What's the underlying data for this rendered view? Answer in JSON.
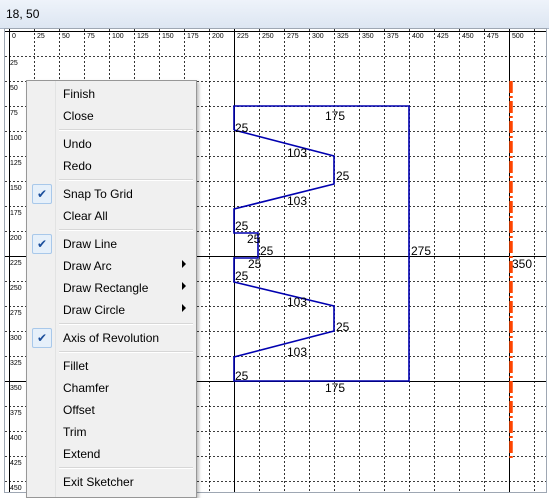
{
  "window": {
    "title": "18, 50"
  },
  "ruler": {
    "x_labels": [
      "0",
      "25",
      "50",
      "75",
      "100",
      "125",
      "150",
      "175",
      "200",
      "225",
      "250",
      "275",
      "300",
      "325",
      "350",
      "375",
      "400",
      "425",
      "450",
      "475",
      "500"
    ],
    "y_labels": [
      "25",
      "50",
      "75",
      "100",
      "125",
      "150",
      "175",
      "200",
      "225",
      "250",
      "275",
      "300",
      "325",
      "350",
      "375",
      "400",
      "425",
      "450"
    ]
  },
  "sketch": {
    "dims": {
      "top": "175",
      "bottom": "175",
      "right": "275",
      "d25_a": "25",
      "d103_a": "103",
      "d25_b": "25",
      "d103_b": "103",
      "d25_c": "25",
      "d25_d": "25",
      "d25_e": "25",
      "d25_f": "25",
      "d25_g": "25",
      "d103_c": "103",
      "d25_h": "25",
      "d103_d": "103",
      "d25_i": "25"
    },
    "axis_label": "350",
    "colors": {
      "profile": "#0000b0",
      "axis": "#ff4500",
      "grid": "#000000"
    }
  },
  "menu": {
    "finish": "Finish",
    "close": "Close",
    "undo": "Undo",
    "redo": "Redo",
    "snap_to_grid": "Snap To Grid",
    "clear_all": "Clear All",
    "draw_line": "Draw Line",
    "draw_arc": "Draw Arc",
    "draw_rectangle": "Draw Rectangle",
    "draw_circle": "Draw Circle",
    "axis_of_revolution": "Axis of Revolution",
    "fillet": "Fillet",
    "chamfer": "Chamfer",
    "offset": "Offset",
    "trim": "Trim",
    "extend": "Extend",
    "exit_sketcher": "Exit Sketcher",
    "check_glyph": "✔"
  }
}
